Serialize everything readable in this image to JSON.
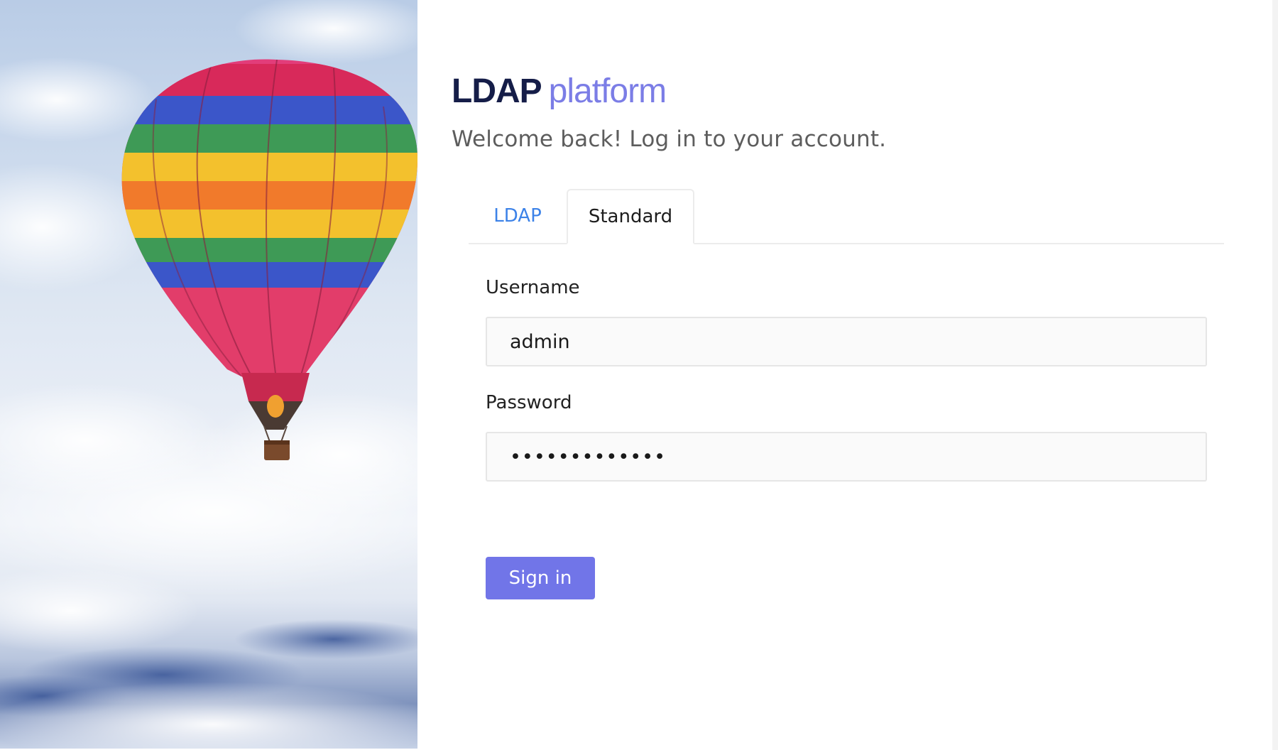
{
  "brand": {
    "primary": "LDAP",
    "secondary": "platform",
    "primary_color": "#151d48",
    "secondary_color": "#7b7de6"
  },
  "welcome_text": "Welcome back! Log in to your account.",
  "tabs": [
    {
      "label": "LDAP",
      "active": false
    },
    {
      "label": "Standard",
      "active": true
    }
  ],
  "form": {
    "username_label": "Username",
    "username_value": "admin",
    "password_label": "Password",
    "password_value": "•••••••••••••",
    "submit_label": "Sign in"
  },
  "hero": {
    "image": "hot-air-balloon-over-clouds"
  },
  "colors": {
    "accent": "#7175e8",
    "link": "#3c82e8"
  }
}
